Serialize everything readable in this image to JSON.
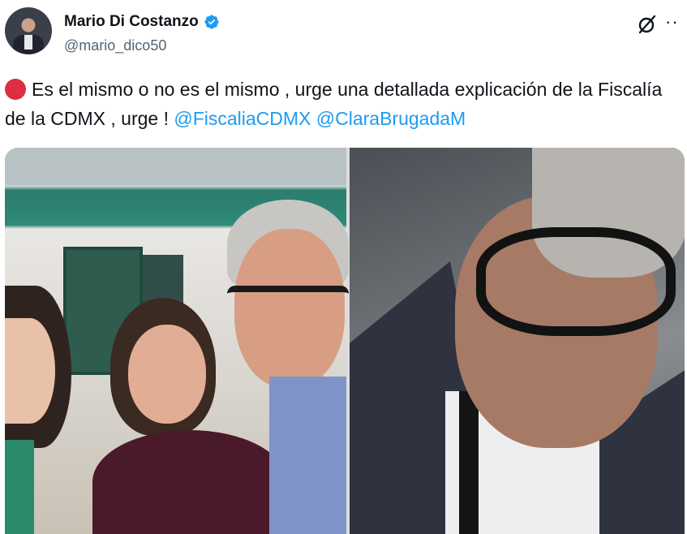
{
  "author": {
    "display_name": "Mario Di Costanzo",
    "handle": "@mario_dico50",
    "verified": true
  },
  "tweet": {
    "text_part1": "Es el mismo o no es el mismo , urge una detallada explicación de la Fiscalía de la CDMX , urge ! ",
    "mention1": "@FiscaliaCDMX",
    "mention2": "@ClaraBrugadaM"
  },
  "icons": {
    "grok": "grok-icon",
    "more": "more-icon",
    "verified": "verified-badge-icon",
    "emoji": "red-circle-icon"
  },
  "colors": {
    "link": "#1d9bf0",
    "verified": "#1d9bf0",
    "emoji_red": "#dd2e44",
    "secondary_text": "#536471"
  },
  "media": {
    "count": 2
  }
}
